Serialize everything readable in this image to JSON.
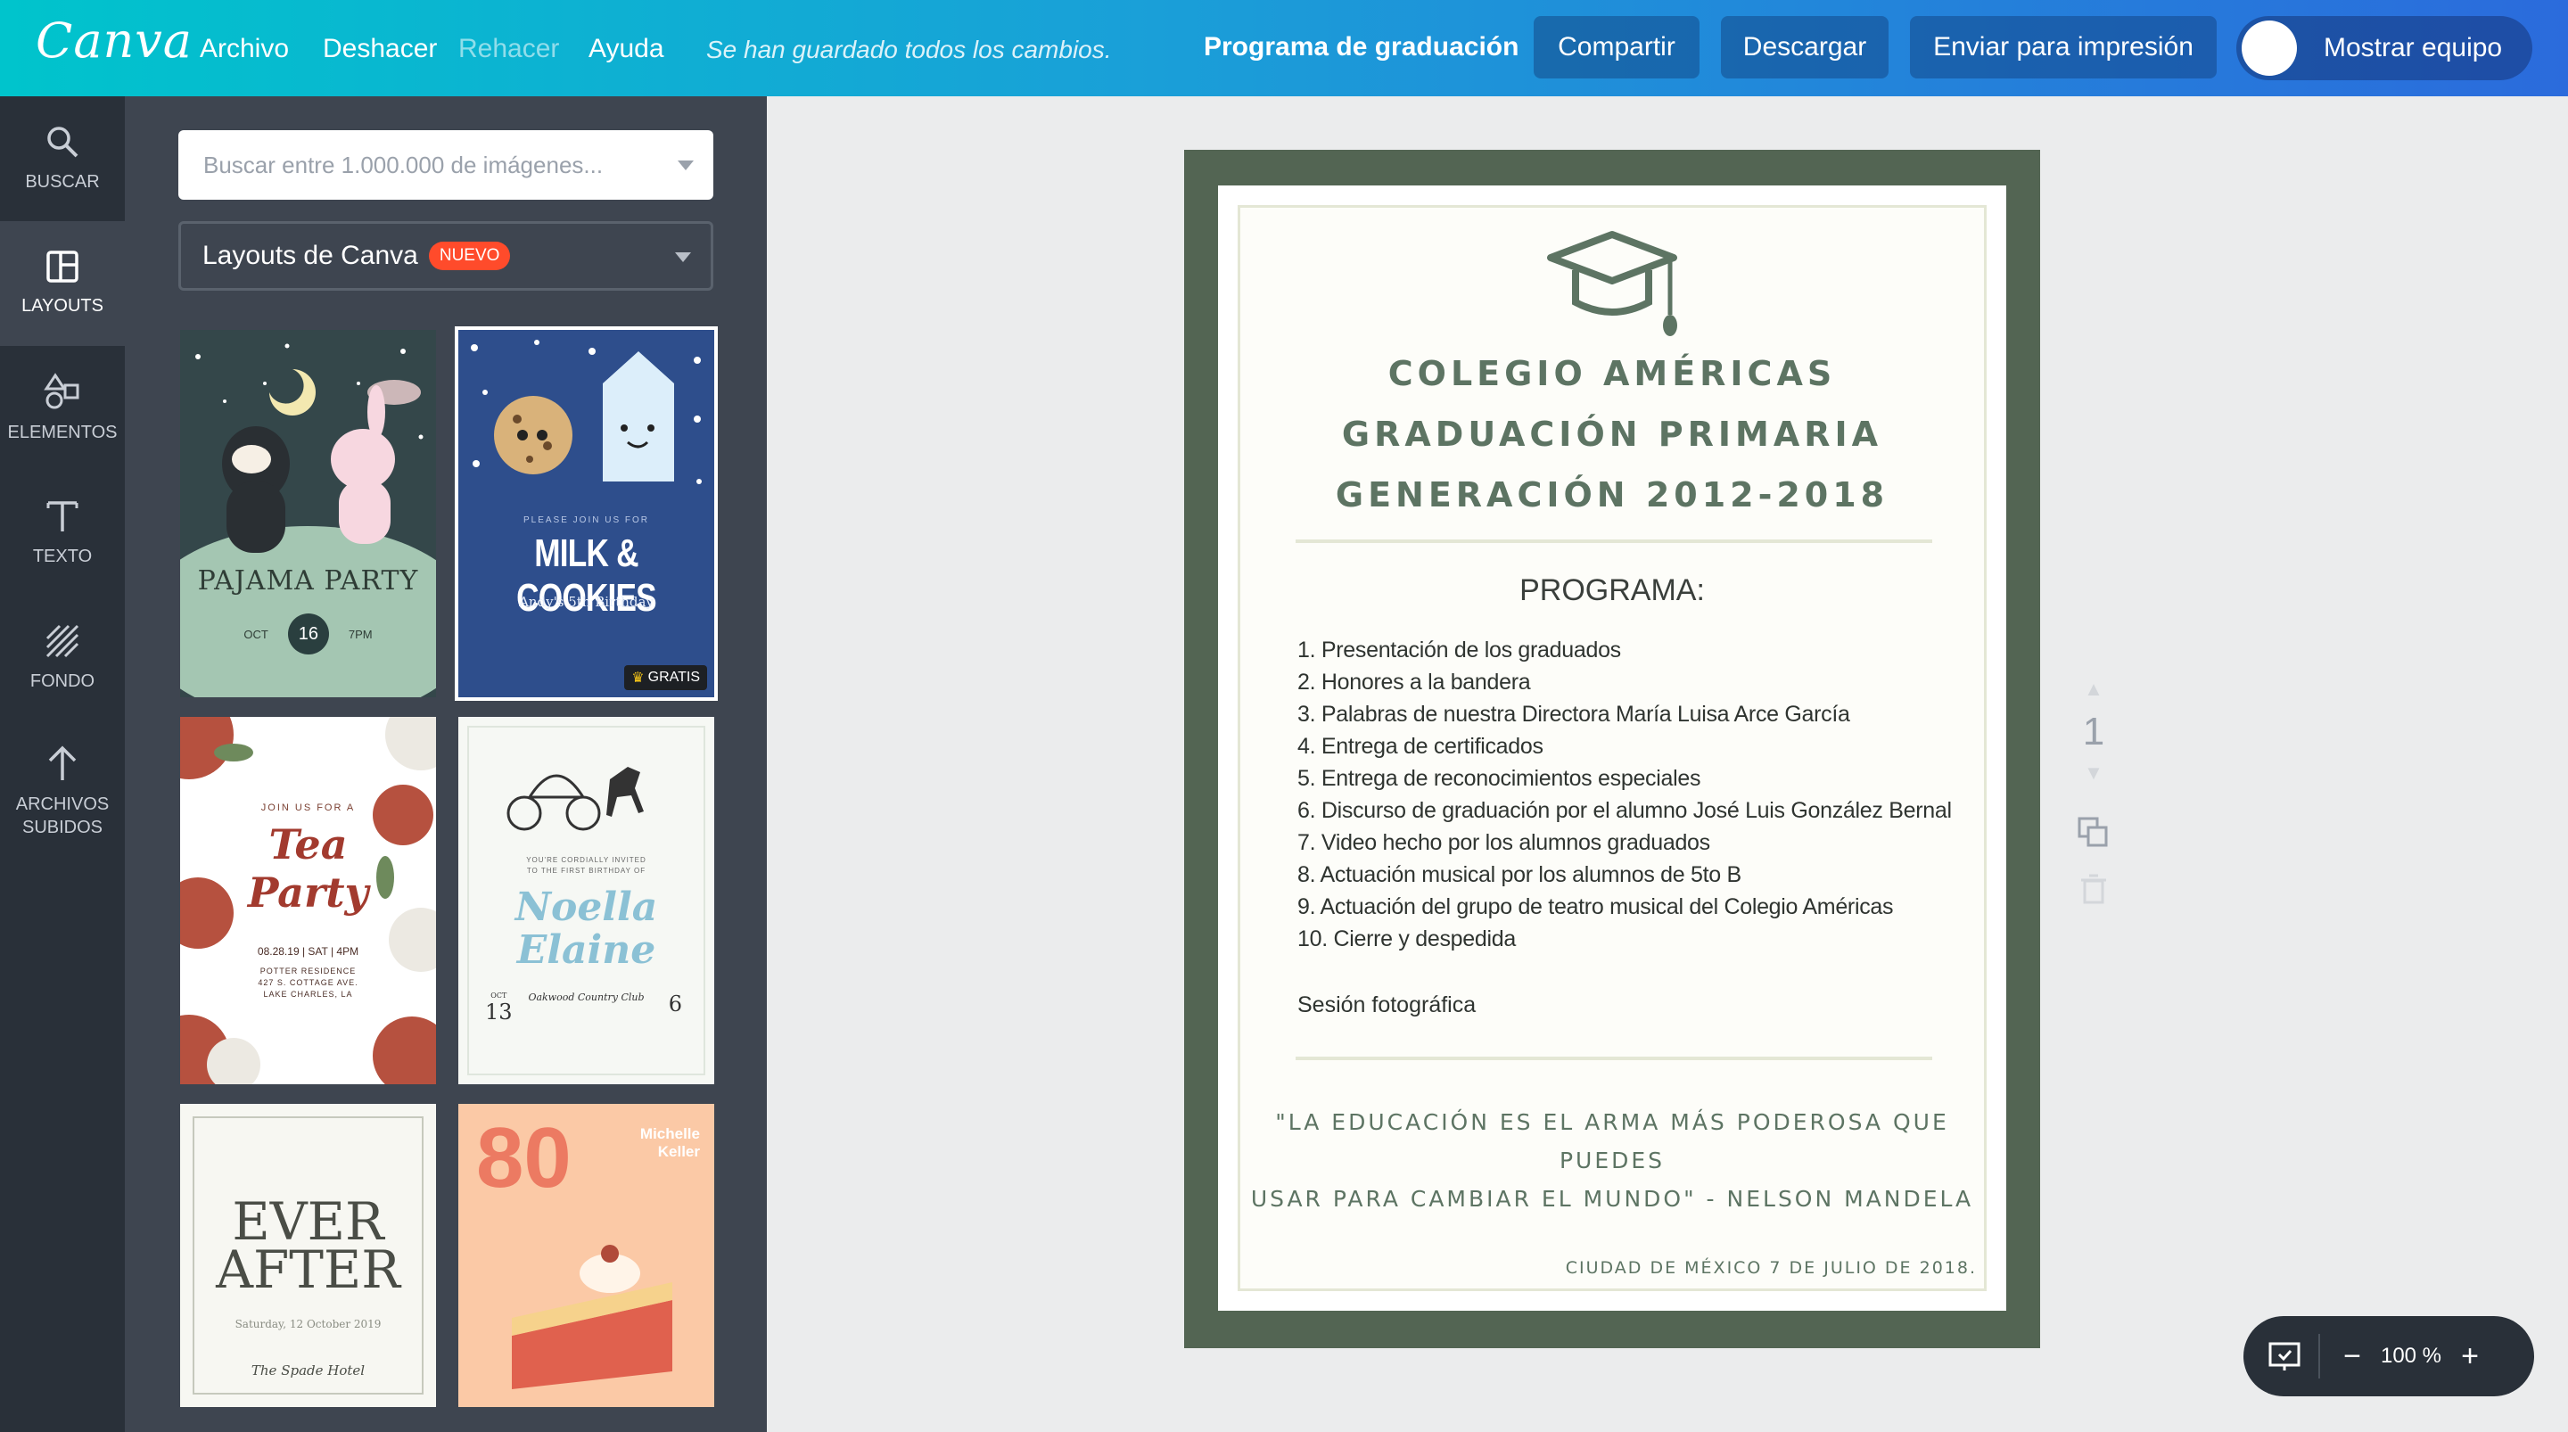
{
  "app": {
    "logo": "Canva",
    "menu": [
      "Archivo",
      "Deshacer",
      "Rehacer",
      "Ayuda"
    ],
    "saved_status": "Se han guardado todos los cambios.",
    "document_title": "Programa de graduación",
    "buttons": {
      "share": "Compartir",
      "download": "Descargar",
      "print": "Enviar para impresión",
      "show_team": "Mostrar equipo"
    },
    "accent": "#00c4cc"
  },
  "rail": [
    {
      "icon": "search-icon",
      "label": "BUSCAR"
    },
    {
      "icon": "layouts-icon",
      "label": "LAYOUTS"
    },
    {
      "icon": "elements-icon",
      "label": "ELEMENTOS"
    },
    {
      "icon": "text-icon",
      "label": "TEXTO"
    },
    {
      "icon": "background-icon",
      "label": "FONDO"
    },
    {
      "icon": "upload-icon",
      "label": "ARCHIVOS\nSUBIDOS"
    }
  ],
  "panel": {
    "search_placeholder": "Buscar entre 1.000.000 de imágenes...",
    "layout_select": "Layouts de Canva",
    "new_badge": "NUEVO",
    "free_badge": "GRATIS",
    "thumbnails": {
      "pajama": {
        "title": "PAJAMA PARTY",
        "month": "OCT",
        "day": "16",
        "time": "7PM"
      },
      "milk": {
        "title": "MILK & COOKIES",
        "invite": "PLEASE JOIN US FOR",
        "subtitle": "Andy's 5th Birthday"
      },
      "tea": {
        "invite": "JOIN US FOR A",
        "line1": "Tea",
        "line2": "Party",
        "date": "08.28.19 | SAT | 4PM",
        "venue": "POTTER RESIDENCE",
        "street": "427 S. COTTAGE AVE.",
        "city": "LAKE CHARLES, LA"
      },
      "noella": {
        "invite": "YOU'RE CORDIALLY INVITED",
        "invite2": "TO THE FIRST BIRTHDAY OF",
        "line1": "Noella",
        "line2": "Elaine",
        "month": "OCT",
        "day": "13",
        "venue": "Oakwood Country Club",
        "time": "6"
      },
      "ever": {
        "line1": "EVER",
        "line2": "AFTER",
        "date": "Saturday, 12 October 2019",
        "venue": "The Spade Hotel"
      },
      "eighty": {
        "number": "80",
        "name1": "Michelle",
        "name2": "Keller"
      }
    }
  },
  "document": {
    "school": [
      "COLEGIO AMÉRICAS",
      "GRADUACIÓN PRIMARIA",
      "GENERACIÓN 2012-2018"
    ],
    "program_title": "PROGRAMA:",
    "program": [
      "1. Presentación de los graduados",
      "2. Honores a la bandera",
      "3. Palabras de nuestra Directora María Luisa Arce García",
      "4. Entrega de certificados",
      "5. Entrega de reconocimientos especiales",
      "6. Discurso de graduación por el alumno José Luis González Bernal",
      "7. Video hecho por los alumnos graduados",
      "8. Actuación musical por los alumnos de 5to B",
      "9. Actuación del grupo de teatro musical del Colegio Américas",
      "10. Cierre y despedida"
    ],
    "session": "Sesión fotográfica",
    "quote": [
      "\"LA EDUCACIÓN ES EL ARMA MÁS PODEROSA QUE PUEDES",
      "USAR PARA CAMBIAR EL MUNDO\" - NELSON MANDELA"
    ],
    "place_date": "CIUDAD DE MÉXICO 7 DE JULIO DE 2018.",
    "page_number": "1",
    "frame_color": "#536553"
  },
  "zoom": {
    "level": "100 %",
    "minus": "−",
    "plus": "+"
  }
}
